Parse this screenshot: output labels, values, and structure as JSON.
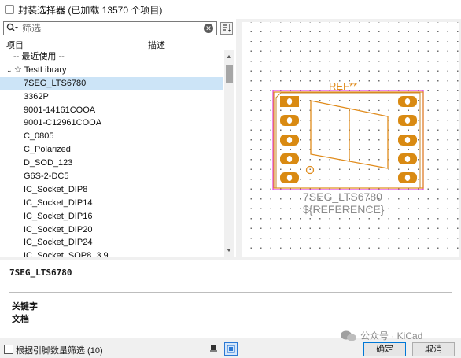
{
  "window": {
    "title": "封装选择器 (已加载 13570 个项目)"
  },
  "search": {
    "placeholder": "筛选",
    "value": "筛选"
  },
  "columns": {
    "item": "项目",
    "description": "描述"
  },
  "tree": {
    "recent": "-- 最近使用 --",
    "library": "☆ TestLibrary",
    "items": [
      "7SEG_LTS6780",
      "3362P",
      "9001-14161COOA",
      "9001-C12961COOA",
      "C_0805",
      "C_Polarized",
      "D_SOD_123",
      "G6S-2-DC5",
      "IC_Socket_DIP8",
      "IC_Socket_DIP14",
      "IC_Socket_DIP16",
      "IC_Socket_DIP20",
      "IC_Socket_DIP24",
      "IC_Socket_SOP8_3.9"
    ],
    "selected_index": 0
  },
  "preview": {
    "ref_text": "REF**",
    "value_text": "7SEG_LTS6780",
    "reference_text": "${REFERENCE}",
    "colors": {
      "pad": "#d98a12",
      "fab": "#e08b1b",
      "courtyard": "#e040e0",
      "silk": "#c68a2f",
      "value_text": "#8a8a8a"
    }
  },
  "info": {
    "footprint_name": "7SEG_LTS6780",
    "keywords_label": "关键字",
    "doc_label": "文档"
  },
  "bottom": {
    "filter_label": "根据引脚数量筛选 (10)",
    "ok_label": "确定",
    "cancel_label": "取消"
  },
  "watermark": {
    "text": "公众号 · KiCad"
  }
}
